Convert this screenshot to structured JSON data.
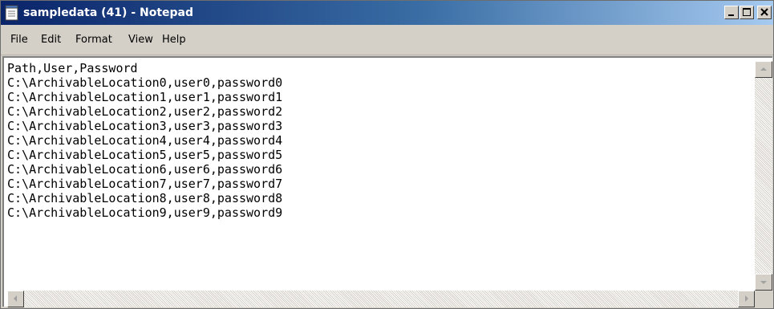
{
  "window": {
    "title": "sampledata (41) - Notepad",
    "app_icon": "notepad-icon",
    "controls": {
      "minimize_icon": "minimize-icon",
      "maximize_icon": "maximize-icon",
      "close_icon": "close-icon"
    }
  },
  "menu": {
    "items": [
      {
        "label": "File"
      },
      {
        "label": "Edit"
      },
      {
        "label": "Format"
      },
      {
        "label": "View"
      },
      {
        "label": "Help"
      }
    ]
  },
  "editor": {
    "lines": [
      "Path,User,Password",
      "C:\\ArchivableLocation0,user0,password0",
      "C:\\ArchivableLocation1,user1,password1",
      "C:\\ArchivableLocation2,user2,password2",
      "C:\\ArchivableLocation3,user3,password3",
      "C:\\ArchivableLocation4,user4,password4",
      "C:\\ArchivableLocation5,user5,password5",
      "C:\\ArchivableLocation6,user6,password6",
      "C:\\ArchivableLocation7,user7,password7",
      "C:\\ArchivableLocation8,user8,password8",
      "C:\\ArchivableLocation9,user9,password9"
    ]
  },
  "colors": {
    "titlebar_start": "#0a246a",
    "titlebar_end": "#a6caf0",
    "chrome": "#d4d0c8",
    "text": "#000000"
  }
}
